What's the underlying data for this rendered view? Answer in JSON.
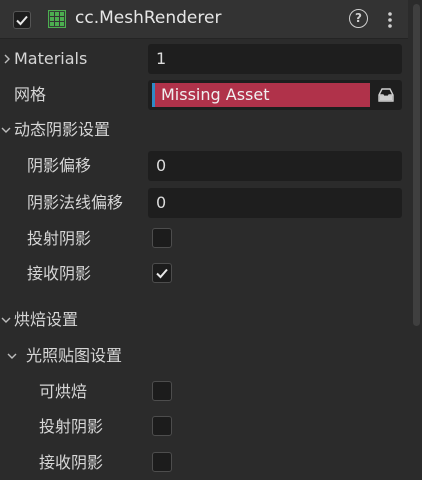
{
  "component": {
    "title": "cc.MeshRenderer",
    "enabled": true,
    "help_glyph": "?",
    "icon": "mesh-grid-icon",
    "more_icon": "vertical-ellipsis-icon"
  },
  "properties": {
    "materials": {
      "label": "Materials",
      "value": "1"
    },
    "mesh": {
      "label": "网格",
      "value": "Missing Asset",
      "browse_icon": "asset-browse-icon"
    }
  },
  "dynamic_shadow": {
    "section_label": "动态阴影设置",
    "shadow_bias": {
      "label": "阴影偏移",
      "value": "0"
    },
    "shadow_normal_bias": {
      "label": "阴影法线偏移",
      "value": "0"
    },
    "cast_shadow": {
      "label": "投射阴影",
      "checked": false
    },
    "receive_shadow": {
      "label": "接收阴影",
      "checked": true
    }
  },
  "bake_settings": {
    "section_label": "烘焙设置",
    "lightmap_settings": {
      "section_label": "光照贴图设置",
      "bakeable": {
        "label": "可烘焙",
        "checked": false
      },
      "cast_shadow": {
        "label": "投射阴影",
        "checked": false
      },
      "receive_shadow": {
        "label": "接收阴影",
        "checked": false
      }
    }
  },
  "colors": {
    "background": "#2b2b2b",
    "field": "#1e1e1e",
    "missing_asset": "#b0324a",
    "asset_accent": "#2d8ac6",
    "component_icon": "#4caf50"
  }
}
